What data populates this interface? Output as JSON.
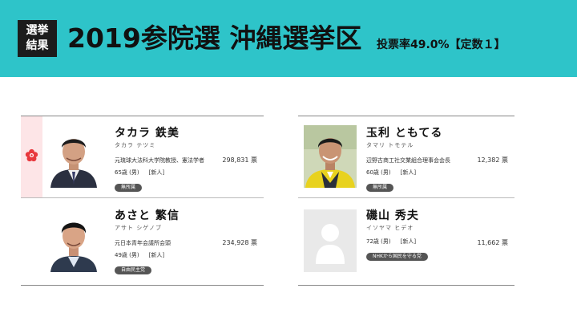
{
  "header": {
    "badge_line1": "選挙",
    "badge_line2": "結果",
    "title": "2019参院選 沖縄選挙区",
    "subtitle": "投票率49.0%【定数１】"
  },
  "colors": {
    "header_bg": "#2ec4c9",
    "winner_strip": "#fde5e7",
    "winner_mark": "#e8383d",
    "party_badge": "#555555"
  },
  "candidates": [
    {
      "name": "タカラ 鉄美",
      "kana": "タカラ テツミ",
      "career": "元琉球大法科大学院教授、憲法学者",
      "age": "65歳 (男)",
      "status": "[新人]",
      "party": "無所属",
      "votes": "298,831 票",
      "elected": true
    },
    {
      "name": "あさと 繁信",
      "kana": "アサト シゲノブ",
      "career": "元日本青年会議所会頭",
      "age": "49歳 (男)",
      "status": "[新人]",
      "party": "自由民主党",
      "votes": "234,928 票",
      "elected": false
    },
    {
      "name": "玉利 ともてる",
      "kana": "タマリ トモテル",
      "career": "辺野古商工社交業組合理事会会長",
      "age": "60歳 (男)",
      "status": "[新人]",
      "party": "無所属",
      "votes": "12,382 票",
      "elected": false
    },
    {
      "name": "磯山 秀夫",
      "kana": "イソヤマ ヒデオ",
      "career": "",
      "age": "72歳 (男)",
      "status": "[新人]",
      "party": "NHKから国民を守る党",
      "votes": "11,662 票",
      "elected": false
    }
  ]
}
